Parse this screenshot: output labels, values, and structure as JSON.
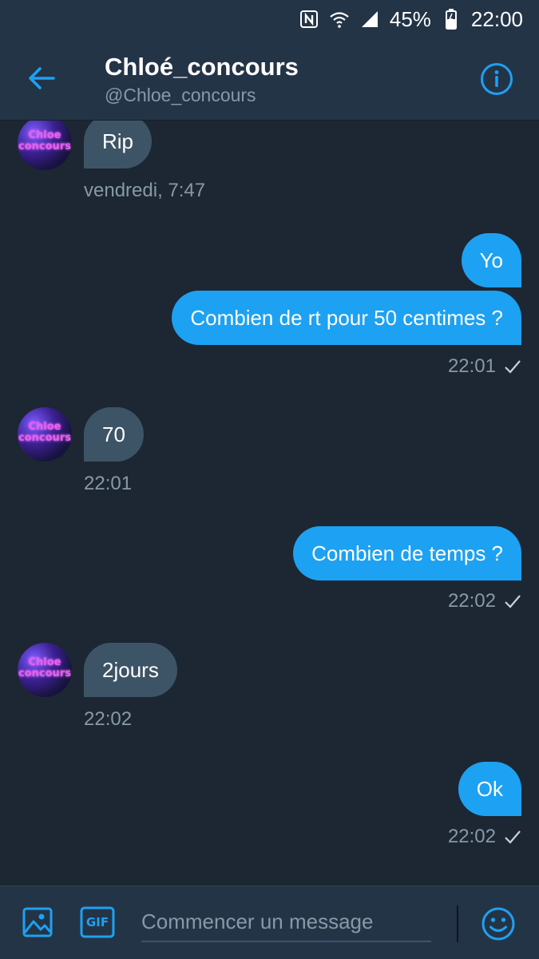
{
  "status_bar": {
    "battery": "45%",
    "time": "22:00",
    "icons": [
      "nfc-icon",
      "wifi-icon",
      "signal-icon",
      "battery-icon"
    ]
  },
  "header": {
    "name": "Chloé_concours",
    "handle": "@Chloe_concours",
    "back_icon": "back-arrow-icon",
    "info_icon": "info-icon"
  },
  "avatar_text": "Chloe concours",
  "messages": [
    {
      "direction": "in",
      "text": "Rip",
      "time": "vendredi, 7:47"
    },
    {
      "direction": "out",
      "text": "Yo"
    },
    {
      "direction": "out",
      "text": "Combien de rt pour 50 centimes ?",
      "time": "22:01",
      "read": true
    },
    {
      "direction": "in",
      "text": "70",
      "time": "22:01"
    },
    {
      "direction": "out",
      "text": "Combien de temps ?",
      "time": "22:02",
      "read": true
    },
    {
      "direction": "in",
      "text": "2jours",
      "time": "22:02"
    },
    {
      "direction": "out",
      "text": "Ok",
      "time": "22:02",
      "read": true
    }
  ],
  "composer": {
    "placeholder": "Commencer un message",
    "gif_label": "GIF",
    "image_icon": "image-icon",
    "emoji_icon": "emoji-icon"
  },
  "colors": {
    "background": "#1c2733",
    "header": "#243447",
    "incoming_bubble": "#3d5466",
    "outgoing_bubble": "#1da1f2",
    "meta_text": "#8899a6",
    "accent": "#1da1f2"
  }
}
